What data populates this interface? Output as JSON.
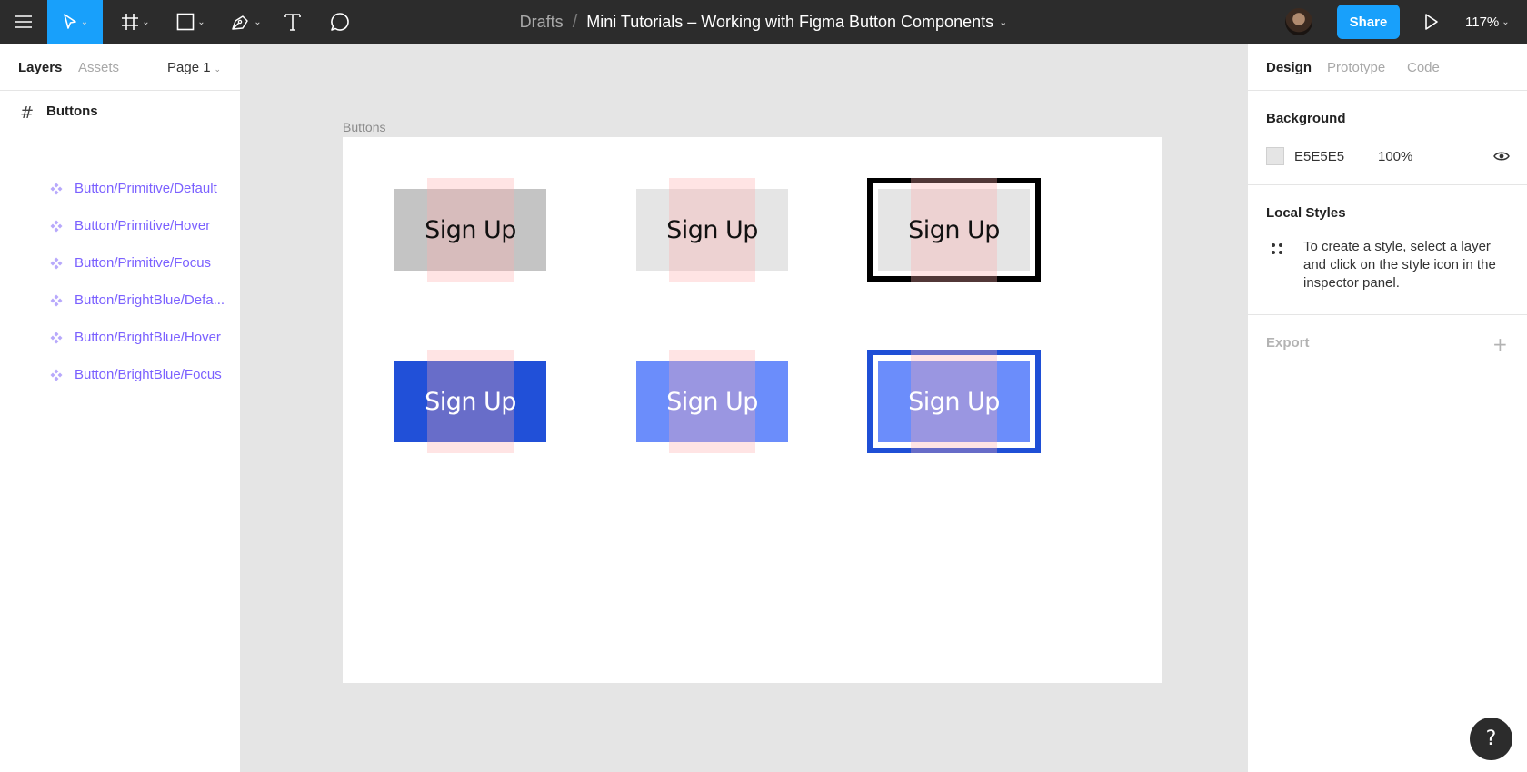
{
  "toolbar": {
    "title": {
      "location": "Drafts",
      "separator": "/",
      "file_name": "Mini Tutorials – Working with Figma Button Components"
    },
    "share_label": "Share",
    "zoom": "117%",
    "tools": [
      "menu-icon",
      "move-icon",
      "frame-icon",
      "rectangle-icon",
      "pen-icon",
      "text-icon",
      "comment-icon"
    ]
  },
  "left_panel": {
    "tabs": [
      "Layers",
      "Assets"
    ],
    "page": "Page 1",
    "frame": "Buttons",
    "layers": [
      "Button/Primitive/Default",
      "Button/Primitive/Hover",
      "Button/Primitive/Focus",
      "Button/BrightBlue/Defa...",
      "Button/BrightBlue/Hover",
      "Button/BrightBlue/Focus"
    ]
  },
  "canvas": {
    "frame_label": "Buttons",
    "buttons": [
      {
        "label": "Sign Up",
        "bg": "#c4c4c4",
        "color": "#111111",
        "focus": false
      },
      {
        "label": "Sign Up",
        "bg": "#e5e5e5",
        "color": "#111111",
        "focus": false
      },
      {
        "label": "Sign Up",
        "bg": "#e5e5e5",
        "color": "#111111",
        "focus": true,
        "ring": "#000000"
      },
      {
        "label": "Sign Up",
        "bg": "#2150d8",
        "color": "#ffffff",
        "focus": false
      },
      {
        "label": "Sign Up",
        "bg": "#6b8dfb",
        "color": "#ffffff",
        "focus": false
      },
      {
        "label": "Sign Up",
        "bg": "#6b8dfb",
        "color": "#ffffff",
        "focus": true,
        "ring": "#1f4fd6"
      }
    ]
  },
  "right_panel": {
    "tabs": [
      "Design",
      "Prototype",
      "Code"
    ],
    "background": {
      "heading": "Background",
      "hex": "E5E5E5",
      "opacity": "100%"
    },
    "local_styles": {
      "heading": "Local Styles",
      "hint": "To create a style, select a layer and click on the style icon in the inspector panel."
    },
    "export": {
      "heading": "Export"
    }
  },
  "help": "?"
}
